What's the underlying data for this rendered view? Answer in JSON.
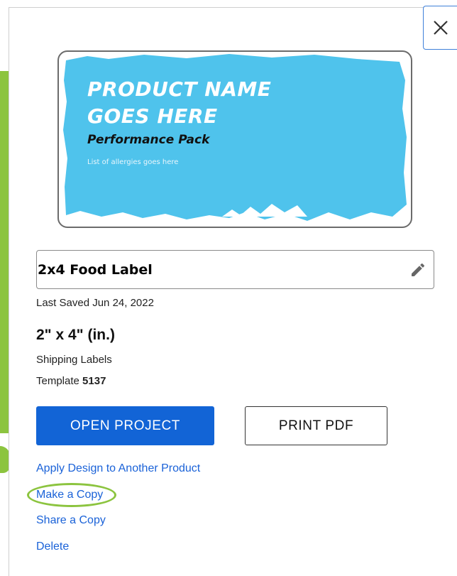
{
  "modal": {
    "close_icon": "close-icon"
  },
  "preview": {
    "label_title_line1": "PRODUCT NAME",
    "label_title_line2": "GOES HERE",
    "label_subtitle": "Performance Pack",
    "label_allergies": "List of allergies goes here",
    "accent_color": "#4fc3ec"
  },
  "project": {
    "name": "2x4 Food Label",
    "last_saved": "Last Saved Jun 24, 2022",
    "size": "2\" x 4\" (in.)",
    "category": "Shipping Labels",
    "template_prefix": "Template",
    "template_number": "5137"
  },
  "actions": {
    "open_project": "OPEN PROJECT",
    "print_pdf": "PRINT PDF",
    "apply_design": "Apply Design to Another Product",
    "make_copy": "Make a Copy",
    "share_copy": "Share a Copy",
    "delete": "Delete"
  },
  "colors": {
    "primary_button": "#1264d6",
    "link": "#1a62d8",
    "highlight": "#8cc43f"
  }
}
